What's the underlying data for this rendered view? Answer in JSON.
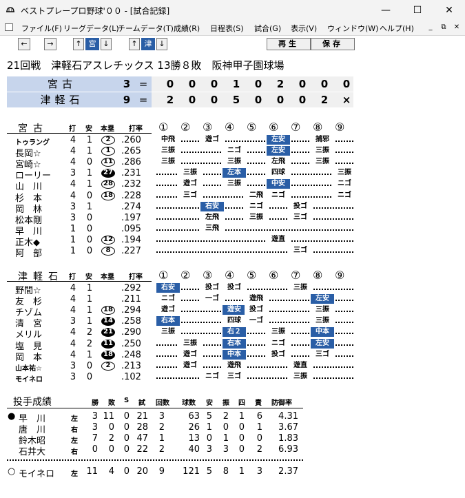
{
  "window": {
    "title": "ベストプレープロ野球'００ - [試合記録]",
    "minimize": "—",
    "maximize": "☐",
    "close": "✕"
  },
  "menu": [
    "ファイル(F)",
    "リーグデータ(L)",
    "チームデータ(T)",
    "成績(R)",
    "日程表(S)",
    "試合(G)",
    "表示(V)",
    "ウィンドウ(W)",
    "ヘルプ(H)"
  ],
  "mdi": {
    "min": "_",
    "restore": "⧉",
    "close": "✕"
  },
  "toolbar": {
    "prev": "←",
    "next": "→",
    "up1": "↑",
    "team1": "宮",
    "down1": "↓",
    "up2": "↑",
    "team2": "津",
    "down2": "↓",
    "play": "再生",
    "save": "保存"
  },
  "game_info": "21回戦　津軽石アスレチックス 13勝８敗　阪神甲子園球場",
  "scoreboard": [
    {
      "team": "宮古",
      "runs": "3",
      "eq": "=",
      "innings": [
        "0",
        "0",
        "0",
        "1",
        "0",
        "2",
        "0",
        "0",
        "0"
      ]
    },
    {
      "team": "津軽石",
      "runs": "9",
      "eq": "=",
      "innings": [
        "2",
        "0",
        "0",
        "5",
        "0",
        "0",
        "0",
        "2",
        "×"
      ]
    }
  ],
  "batting_headers": {
    "ab": "打",
    "h": "安",
    "hr": "本塁",
    "avg": "打率"
  },
  "inning_numbers": [
    "①",
    "②",
    "③",
    "④",
    "⑤",
    "⑥",
    "⑦",
    "⑧",
    "⑨"
  ],
  "teams": [
    {
      "name": "宮古",
      "players": [
        {
          "name": "トゥラング",
          "small": true,
          "ab": "4",
          "h": "1",
          "hr": "2",
          "hr_fill": false,
          "avg": ".260",
          "res": [
            {
              "i": 1,
              "t": "中飛"
            },
            {
              "i": 3,
              "t": "遊ゴ"
            },
            {
              "i": 6,
              "t": "左安",
              "hi": true
            },
            {
              "i": 8,
              "t": "捕邪"
            }
          ]
        },
        {
          "name": "長岡☆",
          "ab": "4",
          "h": "1",
          "hr": "1",
          "hr_fill": false,
          "avg": ".265",
          "res": [
            {
              "i": 1,
              "t": "三振"
            },
            {
              "i": 4,
              "t": "ニゴ"
            },
            {
              "i": 6,
              "t": "左安",
              "hi": true
            },
            {
              "i": 8,
              "t": "三振"
            }
          ]
        },
        {
          "name": "宮崎☆",
          "ab": "4",
          "h": "0",
          "hr": "11",
          "hr_fill": false,
          "avg": ".286",
          "res": [
            {
              "i": 1,
              "t": "三振"
            },
            {
              "i": 4,
              "t": "三振"
            },
            {
              "i": 6,
              "t": "左飛"
            },
            {
              "i": 8,
              "t": "三振"
            }
          ]
        },
        {
          "name": "ローリー",
          "ab": "3",
          "h": "1",
          "hr": "27",
          "hr_fill": true,
          "avg": ".231",
          "res": [
            {
              "i": 2,
              "t": "三振"
            },
            {
              "i": 4,
              "t": "左本",
              "hi": true
            },
            {
              "i": 6,
              "t": "四球"
            },
            {
              "i": 9,
              "t": "三振"
            }
          ]
        },
        {
          "name": "山　川",
          "ab": "4",
          "h": "1",
          "hr": "28",
          "hr_fill": false,
          "avg": ".232",
          "res": [
            {
              "i": 2,
              "t": "遊ゴ"
            },
            {
              "i": 4,
              "t": "三振"
            },
            {
              "i": 6,
              "t": "中安",
              "hi": true
            },
            {
              "i": 9,
              "t": "ニゴ"
            }
          ]
        },
        {
          "name": "杉　本",
          "ab": "4",
          "h": "0",
          "hr": "18",
          "hr_fill": false,
          "avg": ".228",
          "res": [
            {
              "i": 2,
              "t": "三ゴ"
            },
            {
              "i": 5,
              "t": "二飛"
            },
            {
              "i": 6,
              "t": "ニゴ"
            },
            {
              "i": 9,
              "t": "ニゴ"
            }
          ]
        },
        {
          "name": "岡　林",
          "ab": "3",
          "h": "1",
          "hr": "",
          "hr_fill": false,
          "avg": ".274",
          "res": [
            {
              "i": 3,
              "t": "右安",
              "hi": true
            },
            {
              "i": 5,
              "t": "ニゴ"
            },
            {
              "i": 7,
              "t": "投ゴ"
            }
          ]
        },
        {
          "name": "松本剛",
          "ab": "3",
          "h": "0",
          "hr": "",
          "hr_fill": false,
          "avg": ".197",
          "res": [
            {
              "i": 3,
              "t": "左飛"
            },
            {
              "i": 5,
              "t": "三振"
            },
            {
              "i": 7,
              "t": "三ゴ"
            }
          ]
        },
        {
          "name": "早　川",
          "ab": "1",
          "h": "0",
          "hr": "",
          "hr_fill": false,
          "avg": ".095",
          "res": [
            {
              "i": 3,
              "t": "三飛"
            }
          ]
        },
        {
          "name": "正木◆",
          "ab": "1",
          "h": "0",
          "hr": "12",
          "hr_fill": false,
          "avg": ".194",
          "res": [
            {
              "i": 6,
              "t": "遊直"
            }
          ]
        },
        {
          "name": "阿　部",
          "ab": "1",
          "h": "0",
          "hr": "8",
          "hr_fill": false,
          "avg": ".227",
          "res": [
            {
              "i": 7,
              "t": "三ゴ"
            }
          ]
        }
      ]
    },
    {
      "name": "津軽石",
      "players": [
        {
          "name": "野間☆",
          "ab": "4",
          "h": "1",
          "hr": "",
          "hr_fill": false,
          "avg": ".292",
          "res": [
            {
              "i": 1,
              "t": "右安",
              "hi": true
            },
            {
              "i": 3,
              "t": "投ゴ"
            },
            {
              "i": 4,
              "t": "投ゴ"
            },
            {
              "i": 7,
              "t": "三振"
            }
          ]
        },
        {
          "name": "友　杉",
          "ab": "4",
          "h": "1",
          "hr": "",
          "hr_fill": false,
          "avg": ".211",
          "res": [
            {
              "i": 1,
              "t": "ニゴ"
            },
            {
              "i": 3,
              "t": "一ゴ"
            },
            {
              "i": 5,
              "t": "遊飛"
            },
            {
              "i": 8,
              "t": "左安",
              "hi": true
            }
          ]
        },
        {
          "name": "チゾム",
          "ab": "4",
          "h": "1",
          "hr": "18",
          "hr_fill": false,
          "avg": ".294",
          "res": [
            {
              "i": 1,
              "t": "遊ゴ"
            },
            {
              "i": 4,
              "t": "遊安",
              "hi": true
            },
            {
              "i": 5,
              "t": "投ゴ"
            },
            {
              "i": 8,
              "t": "三振"
            }
          ]
        },
        {
          "name": "清　宮",
          "ab": "3",
          "h": "1",
          "hr": "14",
          "hr_fill": true,
          "avg": ".258",
          "res": [
            {
              "i": 1,
              "t": "右本",
              "hi": true
            },
            {
              "i": 4,
              "t": "四球"
            },
            {
              "i": 5,
              "t": "一ゴ"
            },
            {
              "i": 8,
              "t": "三振"
            }
          ]
        },
        {
          "name": "メリル",
          "ab": "4",
          "h": "2",
          "hr": "21",
          "hr_fill": true,
          "avg": ".290",
          "res": [
            {
              "i": 1,
              "t": "三振"
            },
            {
              "i": 4,
              "t": "右２",
              "hi": true
            },
            {
              "i": 6,
              "t": "三振"
            },
            {
              "i": 8,
              "t": "中本",
              "hi": true
            }
          ]
        },
        {
          "name": "塩　見",
          "ab": "4",
          "h": "2",
          "hr": "11",
          "hr_fill": true,
          "avg": ".250",
          "res": [
            {
              "i": 2,
              "t": "三振"
            },
            {
              "i": 4,
              "t": "右本",
              "hi": true
            },
            {
              "i": 6,
              "t": "ニゴ"
            },
            {
              "i": 8,
              "t": "左安",
              "hi": true
            }
          ]
        },
        {
          "name": "岡　本",
          "ab": "4",
          "h": "1",
          "hr": "18",
          "hr_fill": true,
          "avg": ".248",
          "res": [
            {
              "i": 2,
              "t": "遊ゴ"
            },
            {
              "i": 4,
              "t": "中本",
              "hi": true
            },
            {
              "i": 6,
              "t": "投ゴ"
            },
            {
              "i": 8,
              "t": "三ゴ"
            }
          ]
        },
        {
          "name": "山本祐☆",
          "small": true,
          "ab": "3",
          "h": "0",
          "hr": "2",
          "hr_fill": false,
          "avg": ".213",
          "res": [
            {
              "i": 2,
              "t": "遊ゴ"
            },
            {
              "i": 4,
              "t": "遊飛"
            },
            {
              "i": 7,
              "t": "遊直"
            }
          ]
        },
        {
          "name": "モイネロ",
          "small": true,
          "ab": "3",
          "h": "0",
          "hr": "",
          "hr_fill": false,
          "avg": ".102",
          "res": [
            {
              "i": 3,
              "t": "ニゴ"
            },
            {
              "i": 4,
              "t": "三ゴ"
            },
            {
              "i": 7,
              "t": "三振"
            }
          ]
        }
      ]
    }
  ],
  "pitching": {
    "title": "投手成績",
    "headers": [
      "勝",
      "敗",
      "S",
      "試",
      "回数",
      "球数",
      "安",
      "振",
      "四",
      "責",
      "防御率"
    ],
    "rows": [
      {
        "mark": "●",
        "name": "早　川",
        "hand": "左",
        "w": "3",
        "l": "11",
        "s": "0",
        "g": "21",
        "ip": "3",
        "pc": "63",
        "h": "5",
        "k": "2",
        "bb": "1",
        "er": "6",
        "era": "4.31"
      },
      {
        "mark": "",
        "name": "唐　川",
        "hand": "右",
        "w": "3",
        "l": "0",
        "s": "0",
        "g": "28",
        "ip": "2",
        "pc": "26",
        "h": "1",
        "k": "0",
        "bb": "0",
        "er": "1",
        "era": "3.67"
      },
      {
        "mark": "",
        "name": "鈴木昭",
        "hand": "左",
        "w": "7",
        "l": "2",
        "s": "0",
        "g": "47",
        "ip": "1",
        "pc": "13",
        "h": "0",
        "k": "1",
        "bb": "0",
        "er": "0",
        "era": "1.83"
      },
      {
        "mark": "",
        "name": "石井大",
        "hand": "右",
        "w": "0",
        "l": "0",
        "s": "0",
        "g": "22",
        "ip": "2",
        "pc": "40",
        "h": "3",
        "k": "3",
        "bb": "0",
        "er": "2",
        "era": "6.93"
      }
    ],
    "winner": {
      "mark": "○",
      "name": "モイネロ",
      "hand": "左",
      "w": "11",
      "l": "4",
      "s": "0",
      "g": "20",
      "ip": "9",
      "pc": "121",
      "h": "5",
      "k": "8",
      "bb": "1",
      "er": "3",
      "era": "2.37"
    }
  }
}
